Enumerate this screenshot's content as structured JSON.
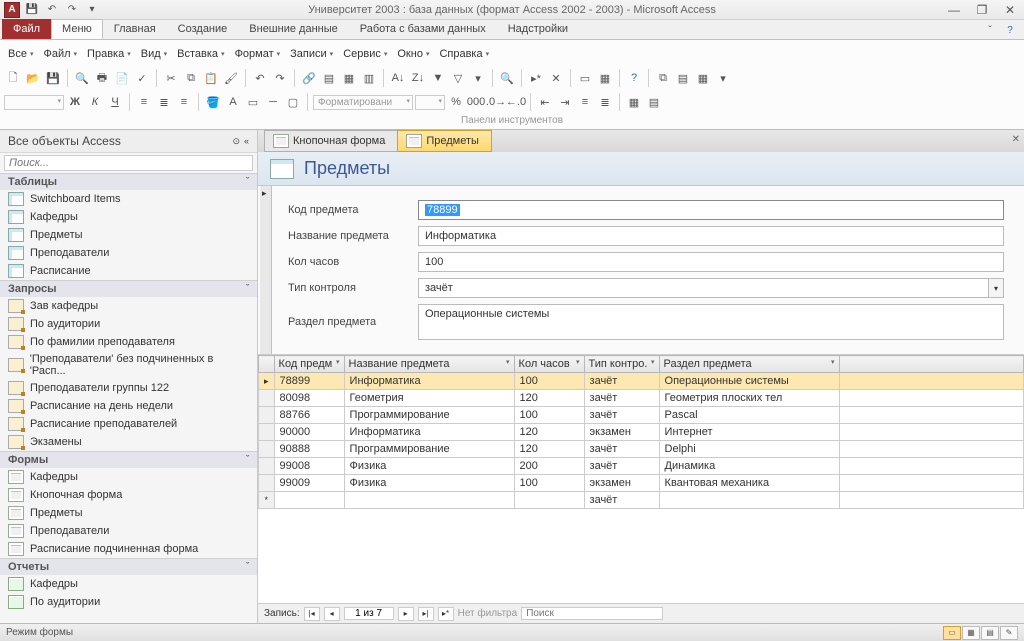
{
  "title": "Университет 2003 : база данных (формат Access 2002 - 2003)  -  Microsoft Access",
  "ribbon": {
    "file": "Файл",
    "tabs": [
      "Меню",
      "Главная",
      "Создание",
      "Внешние данные",
      "Работа с базами данных",
      "Надстройки"
    ],
    "active_tab": 0
  },
  "menubar": [
    "Все",
    "Файл",
    "Правка",
    "Вид",
    "Вставка",
    "Формат",
    "Записи",
    "Сервис",
    "Окно",
    "Справка"
  ],
  "toolbar_caption": "Панели инструментов",
  "format_dropdown": "Форматировани",
  "nav": {
    "title": "Все объекты Access",
    "search_placeholder": "Поиск...",
    "groups": [
      {
        "name": "Таблицы",
        "type": "table",
        "items": [
          "Switchboard Items",
          "Кафедры",
          "Предметы",
          "Преподаватели",
          "Расписание"
        ]
      },
      {
        "name": "Запросы",
        "type": "query",
        "items": [
          "Зав кафедры",
          "По аудитории",
          "По фамилии преподавателя",
          "'Преподаватели' без подчиненных в 'Расп...",
          "Преподаватели группы 122",
          "Расписание на день недели",
          "Расписание преподавателей",
          "Экзамены"
        ]
      },
      {
        "name": "Формы",
        "type": "form",
        "items": [
          "Кафедры",
          "Кнопочная форма",
          "Предметы",
          "Преподаватели",
          "Расписание подчиненная форма"
        ]
      },
      {
        "name": "Отчеты",
        "type": "report",
        "items": [
          "Кафедры",
          "По аудитории"
        ]
      }
    ]
  },
  "doc_tabs": [
    {
      "label": "Кнопочная форма",
      "active": false
    },
    {
      "label": "Предметы",
      "active": true
    }
  ],
  "form": {
    "title": "Предметы",
    "fields": [
      {
        "label": "Код предмета",
        "value": "78899",
        "selected": true
      },
      {
        "label": "Название предмета",
        "value": "Информатика"
      },
      {
        "label": "Кол часов",
        "value": "100"
      },
      {
        "label": "Тип контроля",
        "value": "зачёт",
        "combo": true
      },
      {
        "label": "Раздел предмета",
        "value": "Операционные системы",
        "tall": true
      }
    ]
  },
  "datasheet": {
    "columns": [
      "Код предм",
      "Название предмета",
      "Кол часов",
      "Тип контро.",
      "Раздел предмета"
    ],
    "rows": [
      [
        "78899",
        "Информатика",
        "100",
        "зачёт",
        "Операционные системы"
      ],
      [
        "80098",
        "Геометрия",
        "120",
        "зачёт",
        "Геометрия плоских тел"
      ],
      [
        "88766",
        "Программирование",
        "100",
        "зачёт",
        "Pascal"
      ],
      [
        "90000",
        "Информатика",
        "120",
        "экзамен",
        "Интернет"
      ],
      [
        "90888",
        "Программирование",
        "120",
        "зачёт",
        "Delphi"
      ],
      [
        "99008",
        "Физика",
        "200",
        "зачёт",
        "Динамика"
      ],
      [
        "99009",
        "Физика",
        "100",
        "экзамен",
        "Квантовая механика"
      ]
    ],
    "new_row_default": "зачёт",
    "selected_row": 0
  },
  "recnav": {
    "label": "Запись:",
    "position": "1 из 7",
    "filter": "Нет фильтра",
    "search": "Поиск"
  },
  "status": {
    "mode": "Режим формы"
  }
}
